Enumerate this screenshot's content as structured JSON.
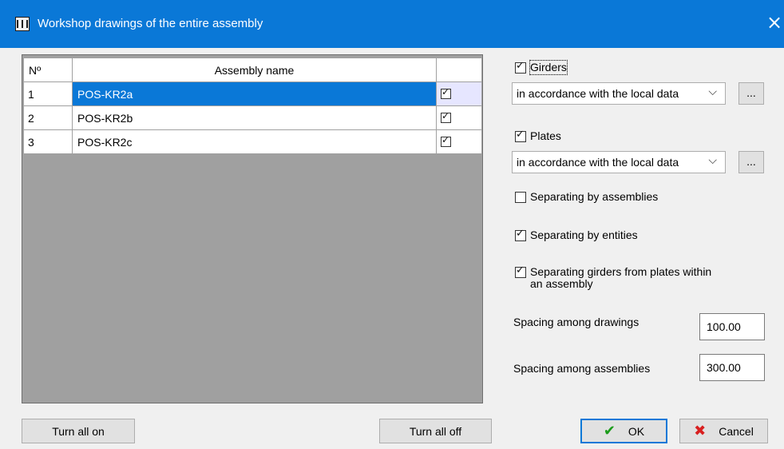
{
  "window": {
    "title": "Workshop drawings of the entire assembly",
    "close_icon": "×"
  },
  "grid": {
    "columns": [
      "Nº",
      "Assembly name",
      ""
    ],
    "rows": [
      {
        "no": "1",
        "name": "POS-KR2a",
        "checked": true,
        "selected": true
      },
      {
        "no": "2",
        "name": "POS-KR2b",
        "checked": true,
        "selected": false
      },
      {
        "no": "3",
        "name": "POS-KR2c",
        "checked": true,
        "selected": false
      }
    ]
  },
  "buttons": {
    "turn_all_on": "Turn all on",
    "turn_all_off": "Turn all off",
    "ok": "OK",
    "cancel": "Cancel",
    "ellipsis": "..."
  },
  "options": {
    "girders": {
      "label": "Girders",
      "checked": true,
      "mode": "in accordance with the local data"
    },
    "plates": {
      "label": "Plates",
      "checked": true,
      "mode": "in accordance with the local data"
    },
    "sep_assemblies": {
      "label": "Separating by assemblies",
      "checked": false
    },
    "sep_entities": {
      "label": "Separating by entities",
      "checked": true
    },
    "sep_girders_plates": {
      "label_line1": "Separating girders from plates within",
      "label_line2": "an assembly",
      "checked": true
    }
  },
  "spacing": {
    "drawings_label": "Spacing among drawings",
    "drawings_value": "100.00",
    "assemblies_label": "Spacing among assemblies",
    "assemblies_value": "300.00"
  },
  "colors": {
    "titlebar": "#0a78d7",
    "selection": "#0a78d7",
    "grid_background": "#a0a0a0"
  }
}
